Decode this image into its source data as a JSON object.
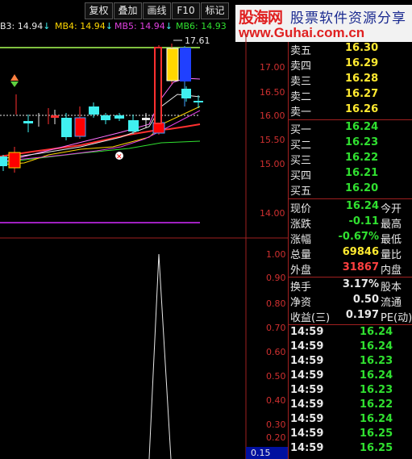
{
  "toolbar": {
    "buttons": [
      "复权",
      "叠加",
      "画线",
      "F10",
      "标记"
    ]
  },
  "watermark": {
    "brand": "股海网",
    "slogan": "股票软件资源分享",
    "url": "www.Guhai.com.cn"
  },
  "ma_legend": [
    {
      "label": "B3: 14.94",
      "arrow": "↓",
      "color": "#e8e8e8"
    },
    {
      "label": "MB4: 14.94",
      "arrow": "↓",
      "color": "#ffd700"
    },
    {
      "label": "MB5: 14.94",
      "arrow": "↓",
      "color": "#e040e0"
    },
    {
      "label": "MB6: 14.93",
      "arrow": "",
      "color": "#30e030"
    }
  ],
  "price_axis": [
    "17.00",
    "16.50",
    "16.00",
    "15.50",
    "15.00",
    "14.00"
  ],
  "volume_axis": [
    "1.00",
    "0.90",
    "0.80",
    "0.70",
    "0.60",
    "0.50",
    "0.40",
    "0.30",
    "0.20",
    "0.15"
  ],
  "high_marker": "17.61",
  "order_book": {
    "sell": [
      {
        "label": "卖五",
        "price": "16.30"
      },
      {
        "label": "卖四",
        "price": "16.29"
      },
      {
        "label": "卖三",
        "price": "16.28"
      },
      {
        "label": "卖二",
        "price": "16.27"
      },
      {
        "label": "卖一",
        "price": "16.26"
      }
    ],
    "buy": [
      {
        "label": "买一",
        "price": "16.24"
      },
      {
        "label": "买二",
        "price": "16.23"
      },
      {
        "label": "买三",
        "price": "16.22"
      },
      {
        "label": "买四",
        "price": "16.21"
      },
      {
        "label": "买五",
        "price": "16.20"
      }
    ]
  },
  "quote": [
    {
      "l": "现价",
      "v": "16.24",
      "r": "今开",
      "color": "#30e030"
    },
    {
      "l": "涨跌",
      "v": "-0.11",
      "r": "最高",
      "color": "#30e030"
    },
    {
      "l": "涨幅",
      "v": "-0.67%",
      "r": "最低",
      "color": "#30e030"
    },
    {
      "l": "总量",
      "v": "69846",
      "r": "量比",
      "color": "#ffea30"
    },
    {
      "l": "外盘",
      "v": "31867",
      "r": "内盘",
      "color": "#ff4040"
    }
  ],
  "fundamentals": [
    {
      "l": "换手",
      "v": "3.17%",
      "r": "股本"
    },
    {
      "l": "净资",
      "v": "0.50",
      "r": "流通"
    },
    {
      "l": "收益(三)",
      "v": "0.197",
      "r": "PE(动)"
    }
  ],
  "ticks": [
    {
      "time": "14:59",
      "price": "16.24"
    },
    {
      "time": "14:59",
      "price": "16.24"
    },
    {
      "time": "14:59",
      "price": "16.23"
    },
    {
      "time": "14:59",
      "price": "16.24"
    },
    {
      "time": "14:59",
      "price": "16.23"
    },
    {
      "time": "14:59",
      "price": "16.22"
    },
    {
      "time": "14:59",
      "price": "16.24"
    },
    {
      "time": "14:59",
      "price": "16.25"
    },
    {
      "time": "14:59",
      "price": "16.25"
    }
  ],
  "colors": {
    "up": "#ff3030",
    "down": "#40f0f0",
    "grid": "#a02020",
    "price_down": "#30e030"
  }
}
